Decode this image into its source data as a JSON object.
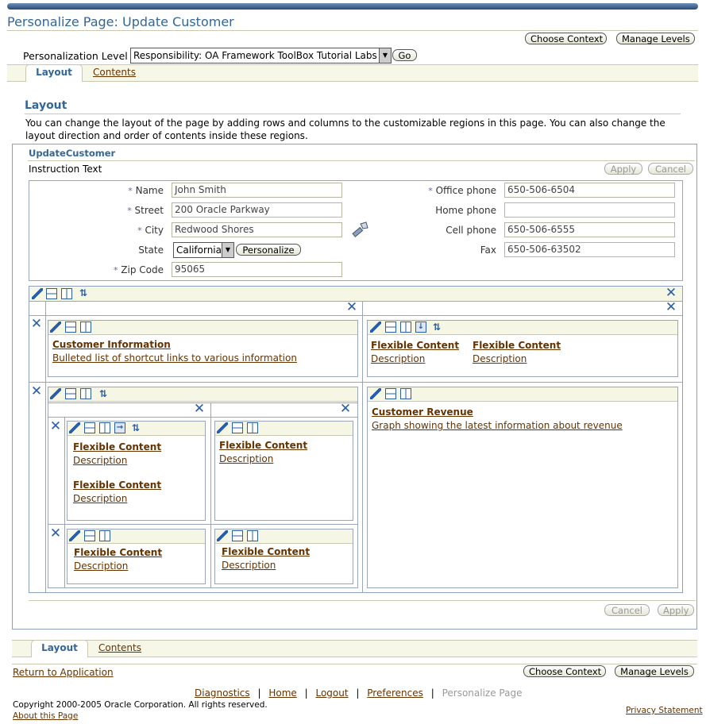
{
  "page": {
    "title": "Personalize Page: Update Customer",
    "choose_context": "Choose Context",
    "manage_levels": "Manage Levels",
    "personalization_level_label": "Personalization Level",
    "personalization_level_value": "Responsibility: OA Framework ToolBox Tutorial Labs",
    "go": "Go"
  },
  "tabs": [
    {
      "label": "Layout",
      "active": true
    },
    {
      "label": "Contents",
      "active": false
    }
  ],
  "layout_section": {
    "heading": "Layout",
    "description": "You can change the layout of the page by adding rows and columns to the customizable regions in this page. You can also change the layout direction and order of contents inside these regions."
  },
  "region": {
    "name": "UpdateCustomer",
    "instruction": "Instruction Text",
    "apply": "Apply",
    "cancel": "Cancel"
  },
  "form_left": [
    {
      "label": "Name",
      "required": true,
      "value": "John Smith"
    },
    {
      "label": "Street",
      "required": true,
      "value": "200 Oracle Parkway"
    },
    {
      "label": "City",
      "required": true,
      "value": "Redwood Shores"
    },
    {
      "label": "State",
      "required": false,
      "value": "California"
    },
    {
      "label": "Zip Code",
      "required": true,
      "value": "95065"
    }
  ],
  "form_right": [
    {
      "label": "Office phone",
      "required": true,
      "value": "650-506-6504"
    },
    {
      "label": "Home phone",
      "required": false,
      "value": ""
    },
    {
      "label": "Cell phone",
      "required": false,
      "value": "650-506-6555"
    },
    {
      "label": "Fax",
      "required": false,
      "value": "650-506-63502"
    }
  ],
  "personalize_button": "Personalize",
  "required_mark": "*",
  "content_items": {
    "customer_info_title": "Customer Information",
    "customer_info_desc": "Bulleted list of shortcut links to various information",
    "flexible_content": "Flexible Content",
    "description": "Description",
    "customer_revenue_title": "Customer Revenue",
    "customer_revenue_desc": "Graph showing the latest information about revenue"
  },
  "footer": {
    "return_link": "Return to Application",
    "links": [
      "Diagnostics",
      "Home",
      "Logout",
      "Preferences"
    ],
    "current": "Personalize Page",
    "separator": "|",
    "copyright": "Copyright 2000-2005 Oracle Corporation. All rights reserved.",
    "about": "About this Page",
    "privacy": "Privacy Statement"
  },
  "icons": [
    "pencil-icon",
    "add-row-icon",
    "add-column-icon",
    "reorder-icon",
    "move-down-icon",
    "remove-icon",
    "flashlight-icon"
  ],
  "colors": {
    "title": "#336699",
    "link": "#663300",
    "icon": "#2a5ea8",
    "tabstrip": "#f7f7e7"
  }
}
